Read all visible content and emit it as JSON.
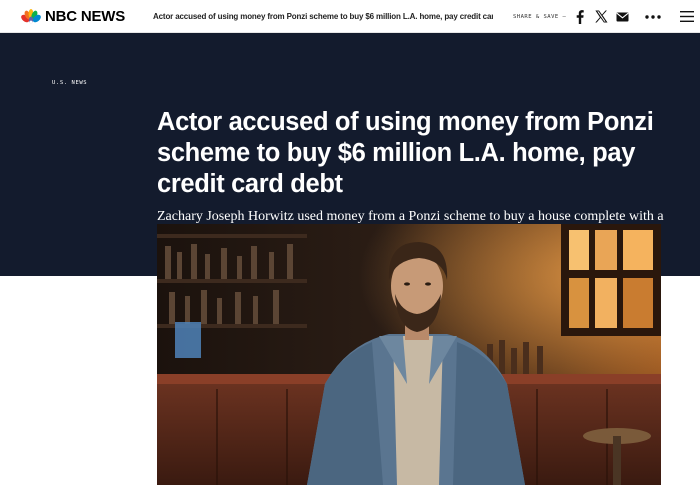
{
  "brand": {
    "logo_text": "NBC NEWS"
  },
  "nav": {
    "headline": "Actor accused of using money from Ponzi scheme to buy $6 million L.A. home, pay credit card debt",
    "share_label": "SHARE & SAVE —"
  },
  "icons": {
    "facebook": "facebook-icon",
    "x": "x-icon",
    "mail": "mail-icon",
    "more": "more-icon",
    "menu": "menu-icon"
  },
  "article": {
    "kicker": "U.S. NEWS",
    "headline": "Actor accused of using money from Ponzi scheme to buy $6 million L.A. home, pay credit card debt",
    "dek": "Zachary Joseph Horwitz used money from a Ponzi scheme to buy a house complete with a wine cellar, a gym, a home theater, a cabana and a spa pool, prosecutors alleged."
  },
  "colors": {
    "hero_background": "#131b2d",
    "text_light": "#ffffff",
    "topbar_background": "#ffffff"
  }
}
